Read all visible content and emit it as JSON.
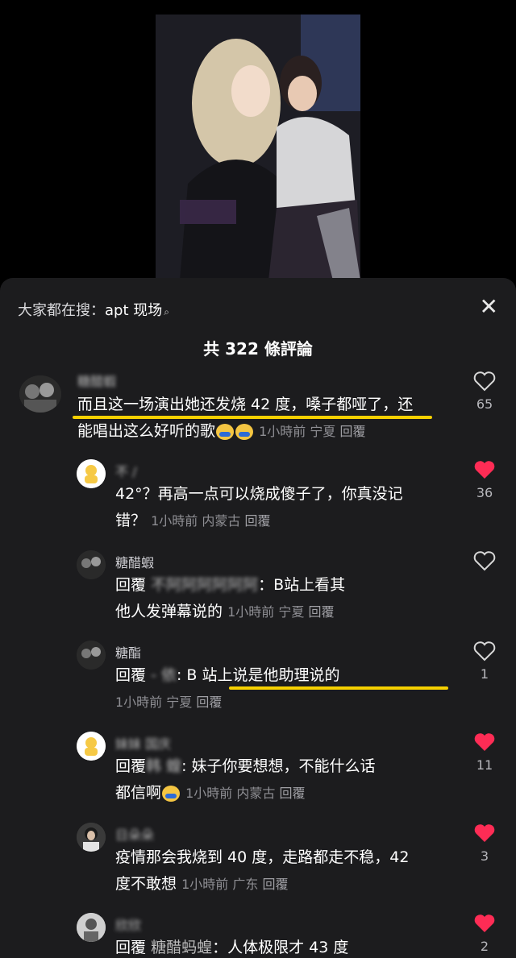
{
  "sheet": {
    "search_label": "大家都在搜：",
    "search_term": "apt 现场",
    "close_icon": "close-icon",
    "count_label": "共 322 條評論"
  },
  "comments": [
    {
      "name": "糖醋蝦",
      "text_part1": "而且这一场演出她还发烧 42 度，嗓子都哑了，还",
      "text_part2": "能唱出这么好听的歌",
      "time": "1小時前",
      "place": "宁夏",
      "reply": "回覆",
      "likes": "65",
      "liked": false
    },
    {
      "name": "不 /",
      "text_part1": "42°？再高一点可以烧成傻子了，你真没记",
      "text_part2": "错？",
      "time": "1小時前",
      "place": "内蒙古",
      "reply": "回覆",
      "likes": "36",
      "liked": true
    },
    {
      "name": "糖醋蝦",
      "prefix": "回覆",
      "target": "不阿阿阿阿阿阿",
      "text_part1": "：B站上看其",
      "text_part2": "他人发弹幕说的",
      "time": "1小時前",
      "place": "宁夏",
      "reply": "回覆",
      "likes": "",
      "liked": false
    },
    {
      "name": "糖酯",
      "prefix": "回覆",
      "target": "- 依",
      "text_part1": ": B 站上说是他助理说的",
      "time": "1小時前",
      "place": "宁夏",
      "reply": "回覆",
      "likes": "1",
      "liked": false
    },
    {
      "name": "妹妹 国庆",
      "prefix": "回覆",
      "target": "韩 蝗",
      "text_part1": ": 妹子你要想想，不能什么话",
      "text_part2": "都信啊",
      "time": "1小時前",
      "place": "内蒙古",
      "reply": "回覆",
      "likes": "11",
      "liked": true
    },
    {
      "name": "日朵朵",
      "text_part1": "疫情那会我烧到 40 度，走路都走不稳，42",
      "text_part2": "度不敢想",
      "time": "1小時前",
      "place": "广东",
      "reply": "回覆",
      "likes": "3",
      "liked": true
    },
    {
      "name": "欣欣",
      "prefix": "回覆",
      "target": "糖醋蚂蝗",
      "text_part1": "：人体极限才 43 度",
      "likes": "2",
      "liked": true
    }
  ],
  "colors": {
    "highlight": "#f6d000",
    "heart": "#fe2c55"
  }
}
